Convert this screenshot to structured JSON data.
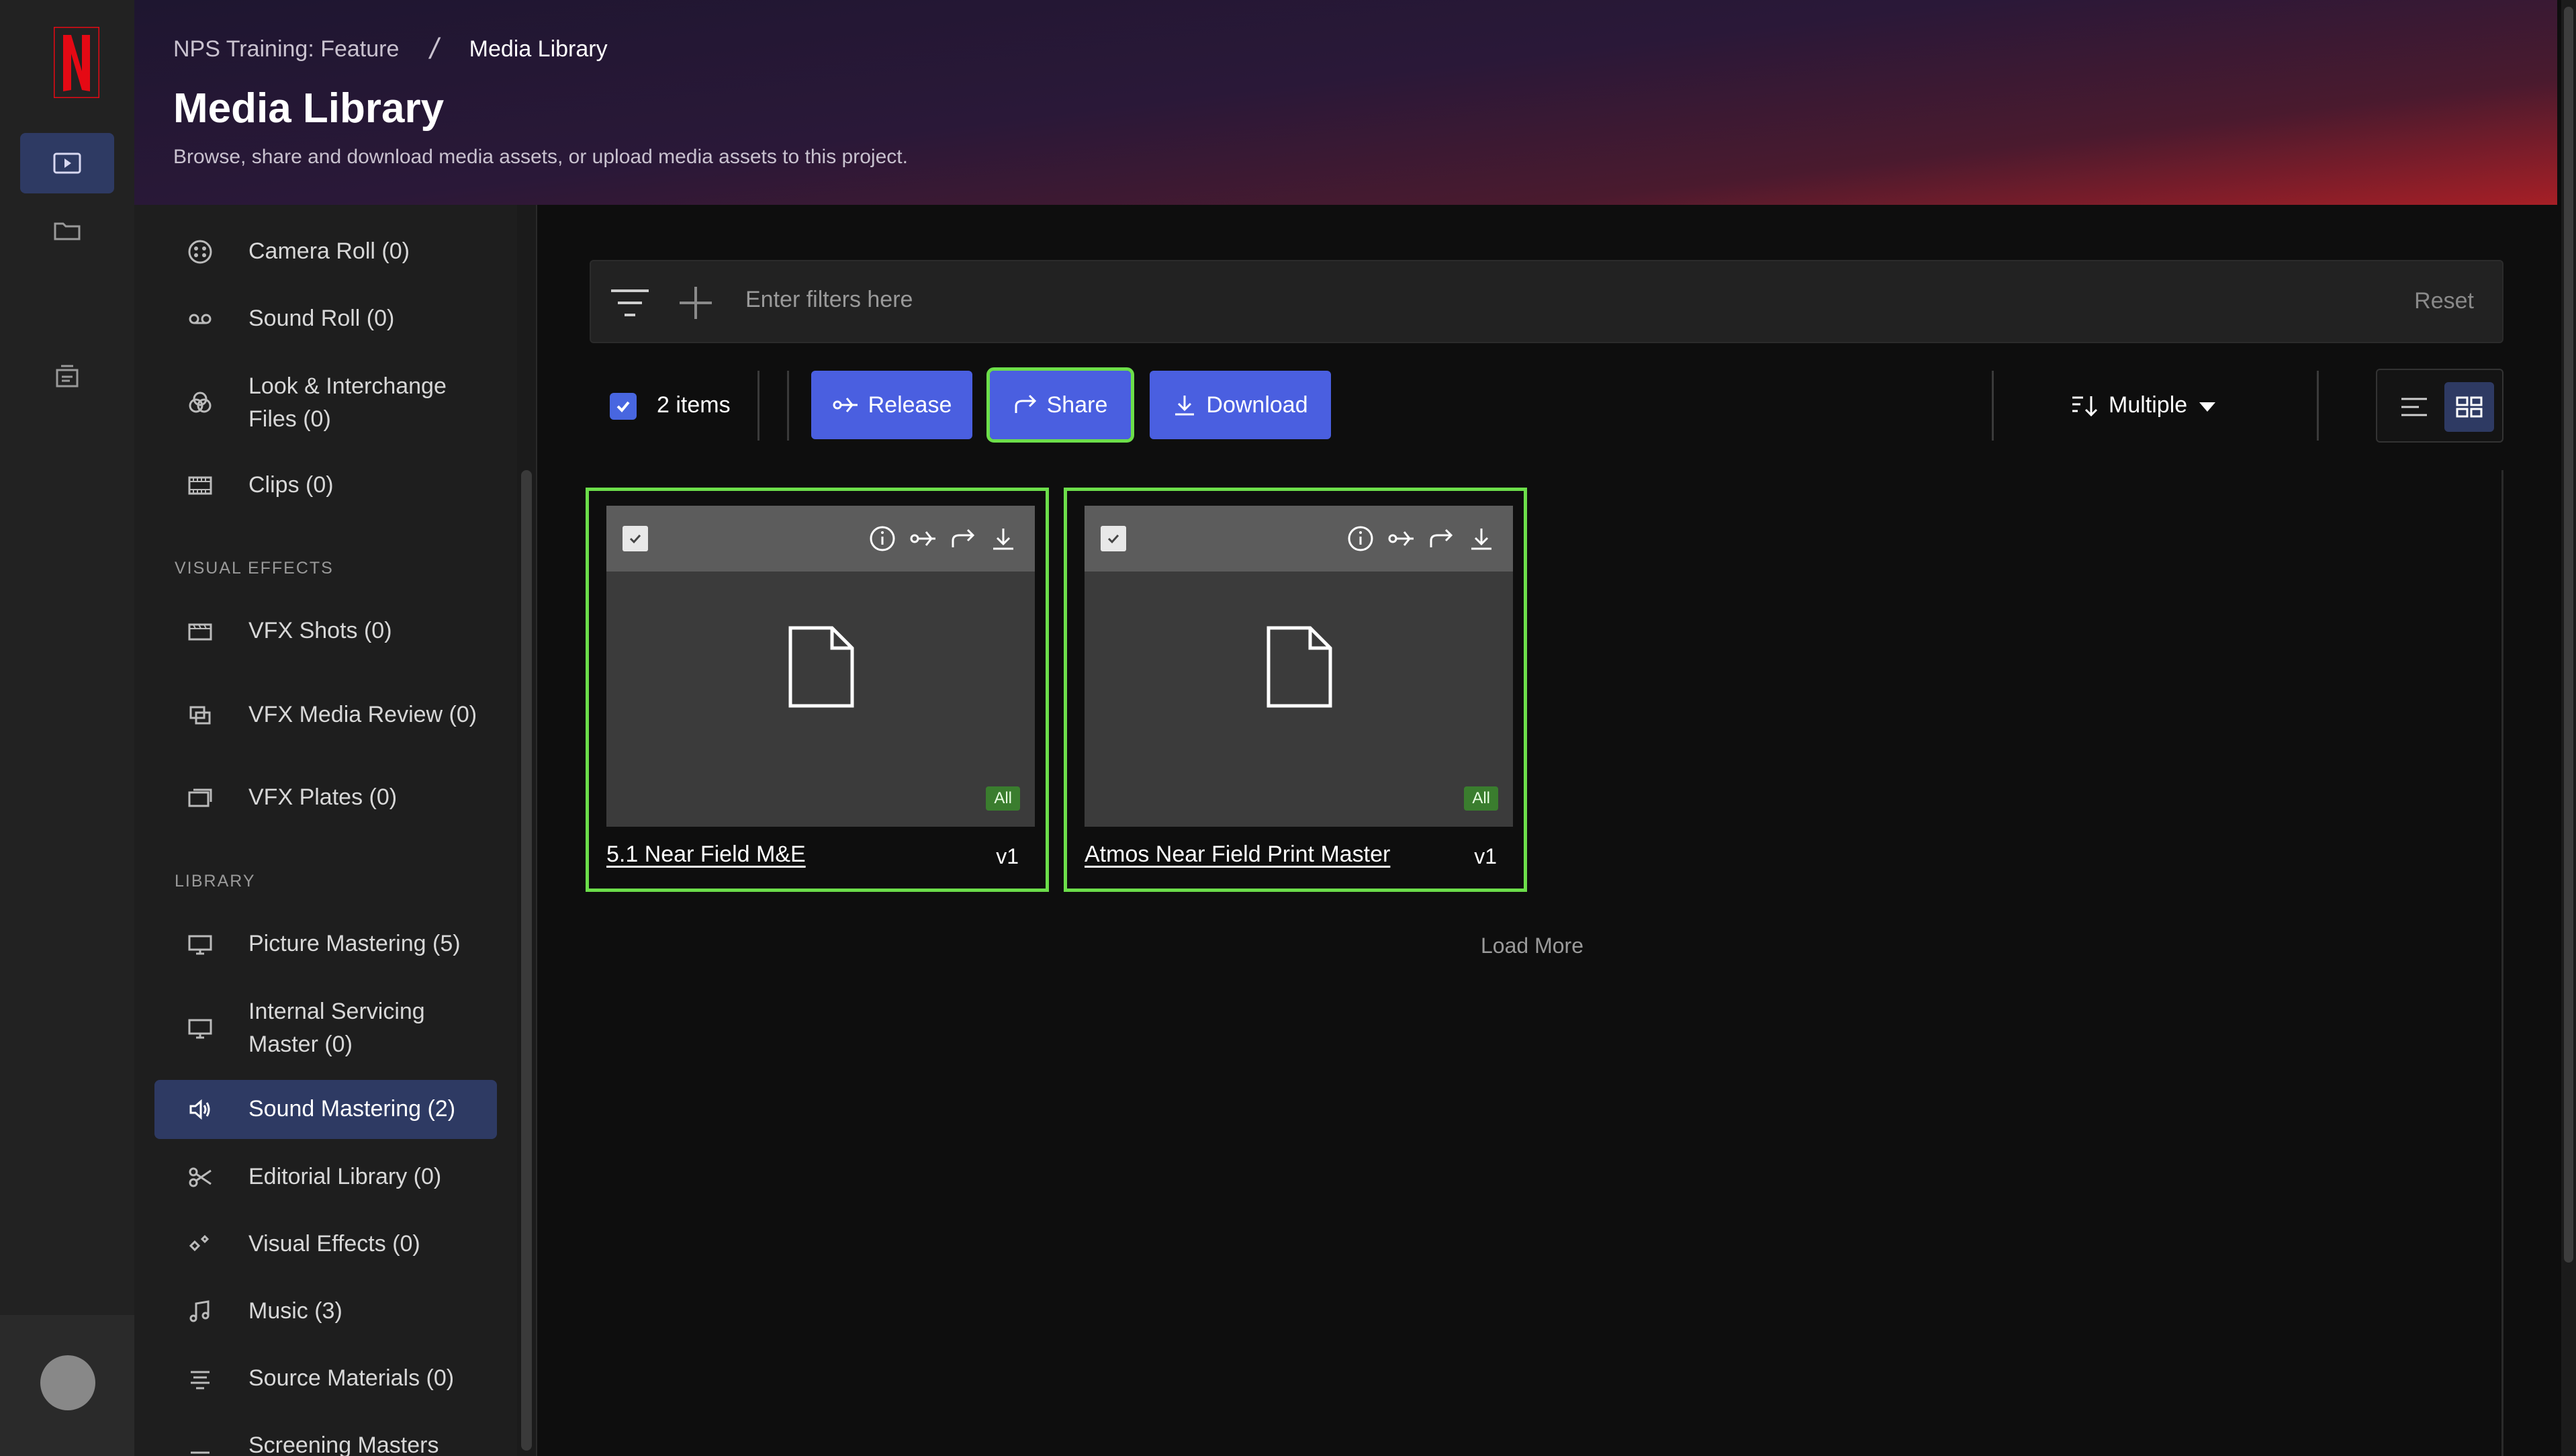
{
  "rail": {
    "logo_letter": "N",
    "brand_color": "#e50914",
    "accent": "#2e3a63"
  },
  "header": {
    "breadcrumb_project": "NPS Training: Feature",
    "breadcrumb_separator": "/",
    "breadcrumb_current": "Media Library",
    "title": "Media Library",
    "subtitle": "Browse, share and download media assets, or upload media assets to this project."
  },
  "sidebar": {
    "items_top": [
      {
        "label": "Camera Roll (0)",
        "icon": "camera-roll-icon"
      },
      {
        "label": "Sound Roll (0)",
        "icon": "tape-icon"
      },
      {
        "label": "Look & Interchange Files (0)",
        "icon": "color-circles-icon"
      },
      {
        "label": "Clips (0)",
        "icon": "film-strip-icon"
      }
    ],
    "section_vfx": "VISUAL EFFECTS",
    "items_vfx": [
      {
        "label": "VFX Shots (0)",
        "icon": "clapper-icon"
      },
      {
        "label": "VFX Media Review (0)",
        "icon": "media-review-icon"
      },
      {
        "label": "VFX Plates (0)",
        "icon": "plates-icon"
      }
    ],
    "section_library": "LIBRARY",
    "items_library": [
      {
        "label": "Picture Mastering (5)",
        "icon": "monitor-icon"
      },
      {
        "label": "Internal Servicing Master (0)",
        "icon": "monitor-icon"
      },
      {
        "label": "Sound Mastering (2)",
        "icon": "speaker-icon",
        "active": true
      },
      {
        "label": "Editorial Library (0)",
        "icon": "scissors-icon"
      },
      {
        "label": "Visual Effects (0)",
        "icon": "sparkle-icon"
      },
      {
        "label": "Music (3)",
        "icon": "music-icon"
      },
      {
        "label": "Source Materials (0)",
        "icon": "source-icon"
      },
      {
        "label": "Screening Masters",
        "icon": "screening-icon"
      }
    ]
  },
  "filter": {
    "placeholder": "Enter filters here",
    "reset_label": "Reset"
  },
  "toolbar": {
    "items_count": "2 items",
    "release_label": "Release",
    "share_label": "Share",
    "download_label": "Download",
    "sort_label": "Multiple",
    "highlight_color": "#6cde4a",
    "button_color": "#4a5fe0"
  },
  "cards": [
    {
      "name": "5.1 Near Field M&E",
      "version": "v1",
      "badge": "All"
    },
    {
      "name": "Atmos Near Field Print Master",
      "version": "v1",
      "badge": "All"
    }
  ],
  "load_more_label": "Load More"
}
